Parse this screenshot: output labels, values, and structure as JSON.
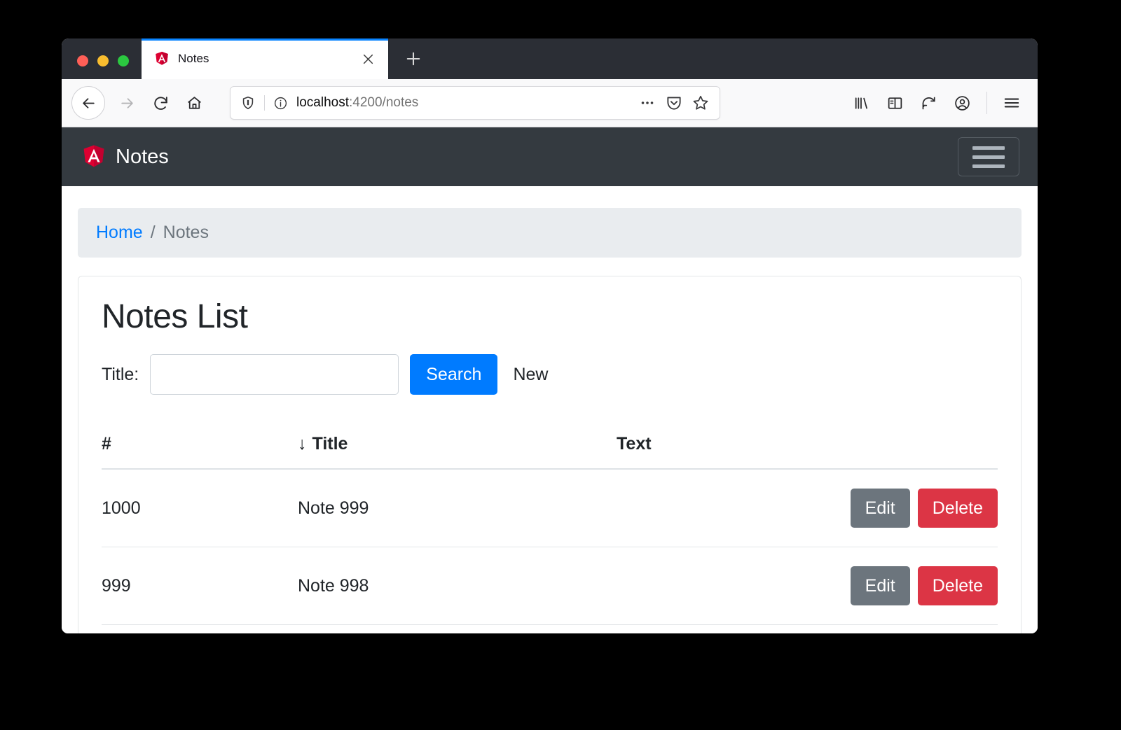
{
  "browser": {
    "tab": {
      "title": "Notes",
      "favicon": "angular-icon",
      "close_label": "✕"
    },
    "new_tab_label": "+",
    "url": {
      "host": "localhost",
      "path": ":4200/notes"
    },
    "toolbar_icons": {
      "back": "back-arrow-icon",
      "forward": "forward-arrow-icon",
      "reload": "reload-icon",
      "home": "home-icon",
      "shield": "shield-icon",
      "info": "info-icon",
      "page_actions": "ellipsis-icon",
      "pocket": "pocket-icon",
      "bookmark": "star-icon",
      "library": "library-icon",
      "sidebar": "sidebar-icon",
      "sync": "sync-icon",
      "account": "account-icon",
      "menu": "hamburger-menu-icon"
    }
  },
  "app": {
    "brand": "Notes",
    "toggler": "navbar-toggler-icon"
  },
  "breadcrumb": {
    "home": "Home",
    "separator": "/",
    "current": "Notes"
  },
  "main": {
    "title": "Notes List",
    "search": {
      "label": "Title:",
      "value": "",
      "placeholder": "",
      "button": "Search",
      "new_link": "New"
    },
    "table": {
      "columns": {
        "num": "#",
        "title": "Title",
        "text": "Text",
        "sort_indicator": "↓"
      },
      "rows": [
        {
          "num": "1000",
          "title": "Note 999",
          "text": "",
          "edit": "Edit",
          "delete": "Delete"
        },
        {
          "num": "999",
          "title": "Note 998",
          "text": "",
          "edit": "Edit",
          "delete": "Delete"
        }
      ]
    }
  },
  "colors": {
    "navbar": "#343a40",
    "primary": "#007bff",
    "secondary": "#6c757d",
    "danger": "#dc3545",
    "breadcrumb_bg": "#e9ecef",
    "angular_red": "#dd0031"
  }
}
